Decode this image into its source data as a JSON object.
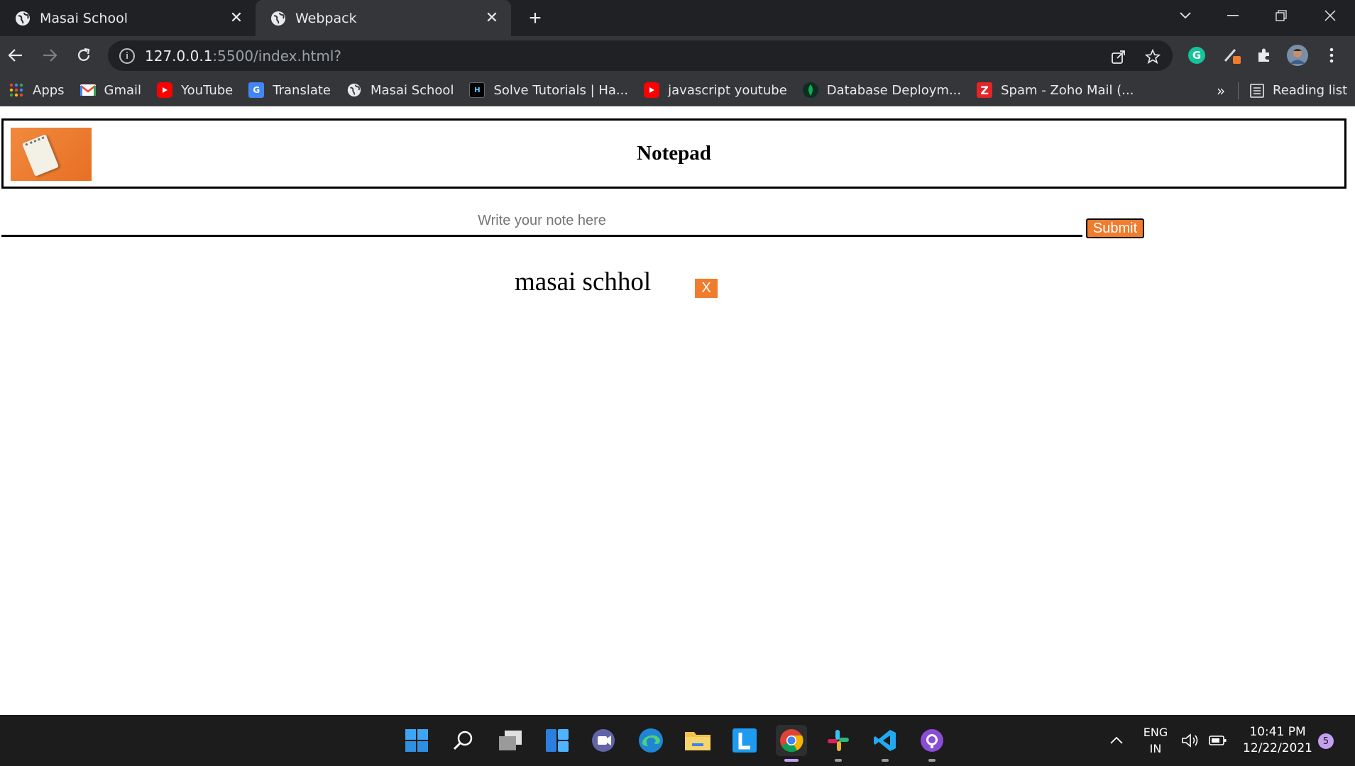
{
  "browser": {
    "tabs": [
      {
        "title": "Masai School",
        "icon": "globe-icon"
      },
      {
        "title": "Webpack",
        "icon": "globe-icon",
        "active": true
      }
    ],
    "url_host": "127.0.0.1",
    "url_path": ":5500/index.html?",
    "bookmarks": [
      {
        "label": "Apps",
        "icon": "apps-grid-icon"
      },
      {
        "label": "Gmail",
        "icon": "gmail-icon"
      },
      {
        "label": "YouTube",
        "icon": "youtube-icon"
      },
      {
        "label": "Translate",
        "icon": "translate-icon"
      },
      {
        "label": "Masai School",
        "icon": "globe-icon"
      },
      {
        "label": "Solve Tutorials | Ha...",
        "icon": "hackerearth-icon"
      },
      {
        "label": "javascript youtube",
        "icon": "youtube-icon"
      },
      {
        "label": "Database Deploym...",
        "icon": "mongodb-icon"
      },
      {
        "label": "Spam - Zoho Mail (...",
        "icon": "zoho-icon"
      }
    ],
    "more_bookmarks": "»",
    "reading_list": "Reading list"
  },
  "app": {
    "title": "Notepad",
    "input_placeholder": "Write your note here",
    "input_value": "",
    "submit_label": "Submit",
    "notes": [
      {
        "text": "masai schhol",
        "delete_label": "X"
      }
    ]
  },
  "taskbar": {
    "language_line1": "ENG",
    "language_line2": "IN",
    "time": "10:41 PM",
    "date": "12/22/2021",
    "notification_count": "5"
  },
  "colors": {
    "accent_orange": "#f07c2e",
    "chrome_dark": "#202124",
    "chrome_toolbar": "#35363a"
  }
}
